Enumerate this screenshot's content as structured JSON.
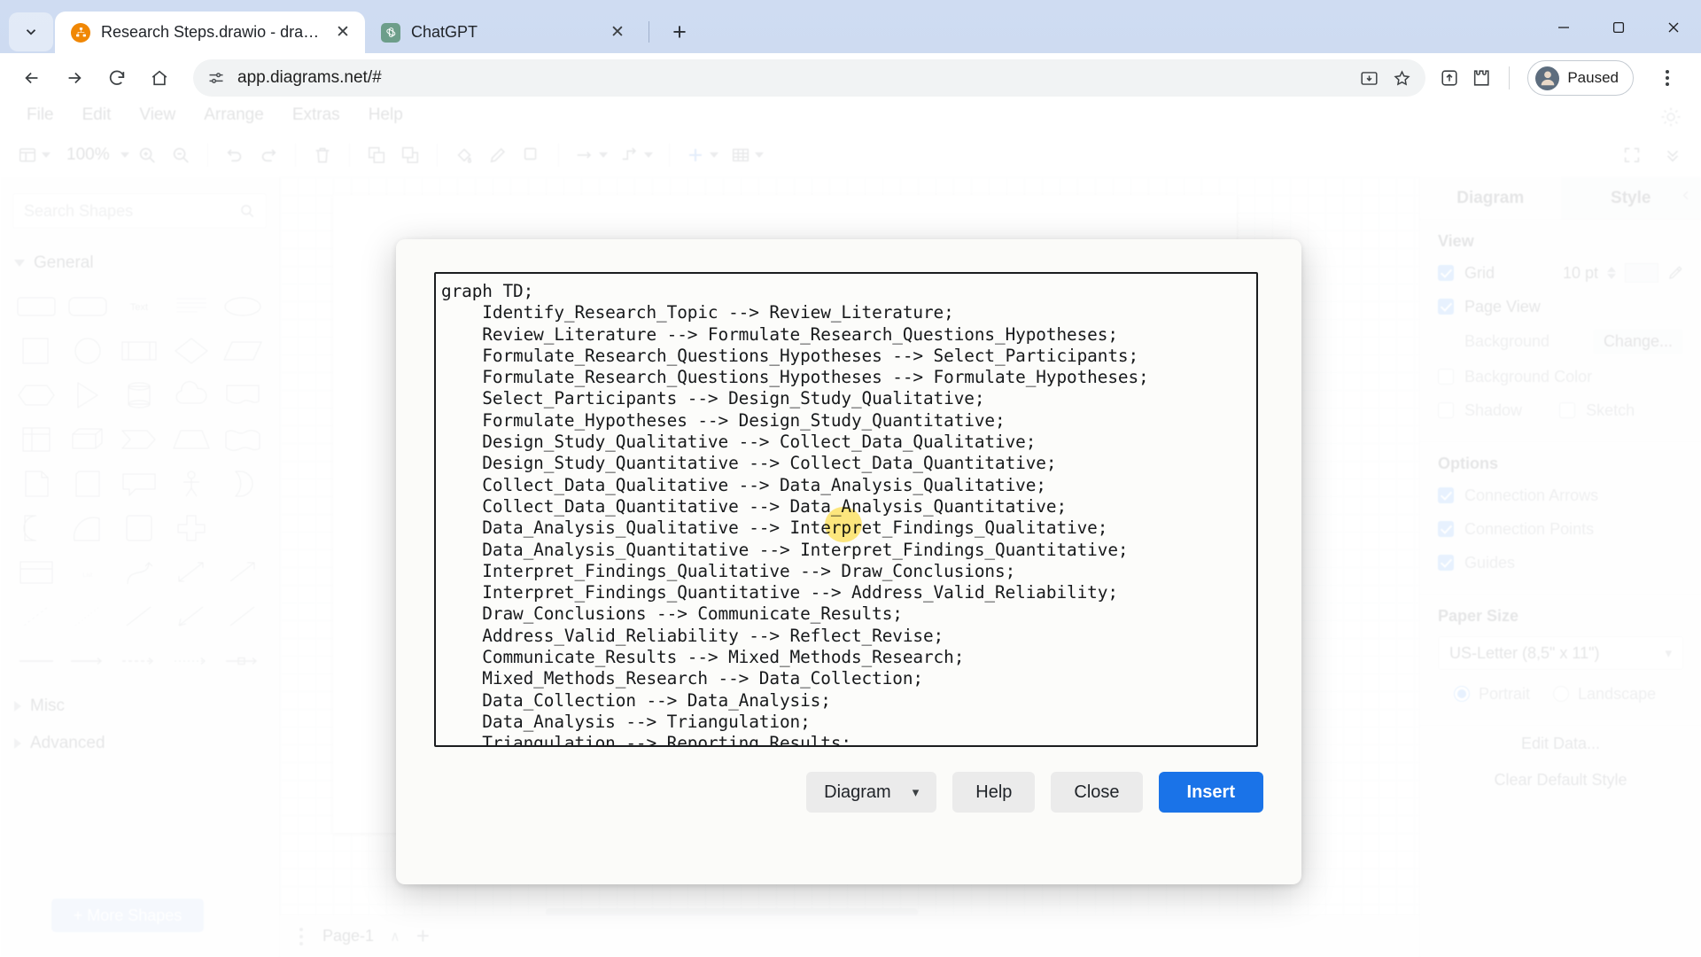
{
  "browser": {
    "tabs": [
      {
        "title": "Research Steps.drawio - draw.io",
        "favicon": "drawio-icon",
        "active": true,
        "close_label": "✕"
      },
      {
        "title": "ChatGPT",
        "favicon": "chatgpt-icon",
        "active": false,
        "close_label": "✕"
      }
    ],
    "new_tab_label": "+",
    "address": "app.diagrams.net/#",
    "profile_label": "Paused",
    "window_controls": {
      "minimize": "minimize-icon",
      "maximize": "maximize-icon",
      "close": "close-icon"
    }
  },
  "app": {
    "menubar": [
      "File",
      "Edit",
      "View",
      "Arrange",
      "Extras",
      "Help"
    ],
    "toolbar": {
      "zoom": "100%"
    },
    "shapes_panel": {
      "search_placeholder": "Search Shapes",
      "sections": [
        {
          "label": "General",
          "expanded": true
        },
        {
          "label": "Misc",
          "expanded": false
        },
        {
          "label": "Advanced",
          "expanded": false
        }
      ],
      "more_shapes_label": "+ More Shapes"
    },
    "statusbar": {
      "page_label": "Page-1",
      "page_chevron": "∧",
      "add_page": "+"
    },
    "format_panel": {
      "tabs": [
        {
          "label": "Diagram",
          "selected": false
        },
        {
          "label": "Style",
          "selected": true
        }
      ],
      "view": {
        "title": "View",
        "grid": {
          "label": "Grid",
          "checked": true,
          "value": "10 pt"
        },
        "page_view": {
          "label": "Page View",
          "checked": true
        },
        "background": {
          "label": "Background",
          "action": "Change..."
        },
        "background_color": {
          "label": "Background Color",
          "checked": false
        },
        "shadow": {
          "label": "Shadow",
          "checked": false
        },
        "sketch": {
          "label": "Sketch",
          "checked": false
        }
      },
      "options": {
        "title": "Options",
        "connection_arrows": {
          "label": "Connection Arrows",
          "checked": true
        },
        "connection_points": {
          "label": "Connection Points",
          "checked": true
        },
        "guides": {
          "label": "Guides",
          "checked": true
        }
      },
      "paper_size": {
        "title": "Paper Size",
        "value": "US-Letter (8,5\" x 11\")",
        "orientation": [
          {
            "label": "Portrait",
            "selected": true
          },
          {
            "label": "Landscape",
            "selected": false
          }
        ]
      },
      "edit_data_label": "Edit Data...",
      "clear_default_style_label": "Clear Default Style"
    }
  },
  "modal": {
    "code": "graph TD;\n    Identify_Research_Topic --> Review_Literature;\n    Review_Literature --> Formulate_Research_Questions_Hypotheses;\n    Formulate_Research_Questions_Hypotheses --> Select_Participants;\n    Formulate_Research_Questions_Hypotheses --> Formulate_Hypotheses;\n    Select_Participants --> Design_Study_Qualitative;\n    Formulate_Hypotheses --> Design_Study_Quantitative;\n    Design_Study_Qualitative --> Collect_Data_Qualitative;\n    Design_Study_Quantitative --> Collect_Data_Quantitative;\n    Collect_Data_Qualitative --> Data_Analysis_Qualitative;\n    Collect_Data_Quantitative --> Data_Analysis_Quantitative;\n    Data_Analysis_Qualitative --> Interpret_Findings_Qualitative;\n    Data_Analysis_Quantitative --> Interpret_Findings_Quantitative;\n    Interpret_Findings_Qualitative --> Draw_Conclusions;\n    Interpret_Findings_Quantitative --> Address_Valid_Reliability;\n    Draw_Conclusions --> Communicate_Results;\n    Address_Valid_Reliability --> Reflect_Revise;\n    Communicate_Results --> Mixed_Methods_Research;\n    Mixed_Methods_Research --> Data_Collection;\n    Data_Collection --> Data_Analysis;\n    Data_Analysis --> Triangulation;\n    Triangulation --> Reporting Results;",
    "format_select": {
      "value": "Diagram",
      "chevron": "⌄"
    },
    "help_label": "Help",
    "close_label": "Close",
    "insert_label": "Insert"
  },
  "colors": {
    "accent": "#1a73e8",
    "checkbox_on": "#4f9df7",
    "cursor_highlight": "#ffe14d",
    "chrome_bg": "#cfdcf2"
  }
}
